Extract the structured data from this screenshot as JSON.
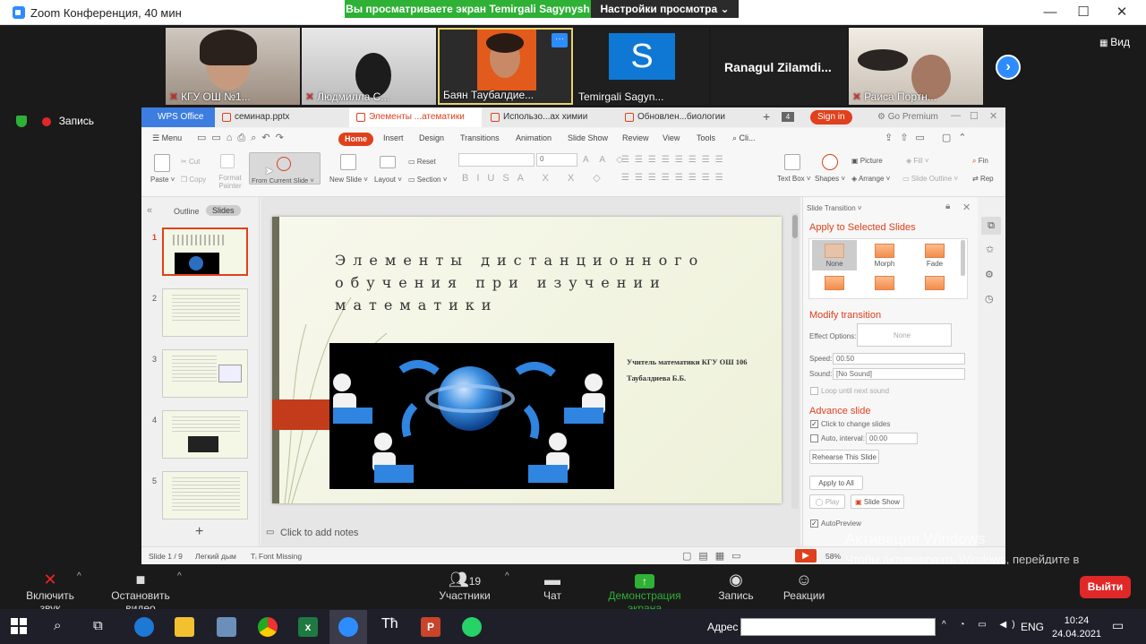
{
  "zoom": {
    "title": "Zoom Конференция, 40 мин",
    "share_banner": "Вы просматриваете экран Temirgali Sagynysh",
    "view_options": "Настройки просмотра ⌄",
    "minimize": "—",
    "maximize": "☐",
    "close": "✕",
    "view_label": "Вид",
    "next_arrow": "›",
    "recording": "Запись",
    "participants": [
      {
        "name": "КГУ ОШ №1..."
      },
      {
        "name": "Людмилла С..."
      },
      {
        "name": "Баян Таубалдие..."
      },
      {
        "name": "Temirgali Sagyn..."
      },
      {
        "name": "Ranagul  Zilamdi..."
      },
      {
        "name": "Раиса Портн..."
      }
    ],
    "tile_more": "···",
    "avatar_letter": "S",
    "toolbar": {
      "unmute": "Включить звук",
      "start_video": "Остановить видео",
      "participants": "Участники",
      "participants_count": "19",
      "chat": "Чат",
      "share": "Демонстрация экрана",
      "record": "Запись",
      "reactions": "Реакции",
      "leave": "Выйти"
    }
  },
  "wps": {
    "tabs": {
      "home": "WPS Office",
      "t1": "семинар.pptx",
      "t2": "Элементы ...атематики",
      "t3": "Использо...ах химии",
      "t4": "Обновлен...биологии"
    },
    "tab_count": "4",
    "sign_in": "Sign in",
    "go_premium": "Go Premium",
    "menu": {
      "menu": "Menu",
      "home": "Home",
      "insert": "Insert",
      "design": "Design",
      "transitions": "Transitions",
      "animation": "Animation",
      "slideshow": "Slide Show",
      "review": "Review",
      "view": "View",
      "tools": "Tools",
      "search": "Cli..."
    },
    "ribbon": {
      "paste": "Paste ˅",
      "cut": "Cut",
      "copy": "Copy",
      "format_painter": "Format Painter",
      "from_current": "From Current Slide ˅",
      "new_slide": "New Slide ˅",
      "layout": "Layout ˅",
      "reset": "Reset",
      "section": "Section ˅",
      "font_size": "0",
      "text_box": "Text Box ˅",
      "shapes": "Shapes ˅",
      "picture": "Picture",
      "fill": "Fill ˅",
      "arrange": "Arrange ˅",
      "slide_outline": "Slide Outline ˅",
      "find": "Fin",
      "replace": "Rep"
    },
    "left_pane": {
      "outline": "Outline",
      "slides": "Slides",
      "add": "+",
      "collapse": "«",
      "numbers": [
        "1",
        "2",
        "3",
        "4",
        "5"
      ]
    },
    "slide": {
      "title": "Элементы дистанционного обучения при изучении математики",
      "teacher_line1": "Учитель математики  КГУ ОШ 106",
      "teacher_line2": "Таубалдиева Б.Б."
    },
    "notes": "Click to add notes",
    "right_pane": {
      "header": "Slide Transition ˅",
      "apply_selected": "Apply to Selected Slides",
      "transitions": [
        "None",
        "Morph",
        "Fade"
      ],
      "modify": "Modify transition",
      "effect_options": "Effect Options:",
      "effect_value": "None",
      "speed_label": "Speed:",
      "speed_value": "00.50",
      "sound_label": "Sound:",
      "sound_value": "[No Sound]",
      "loop": "Loop until next sound",
      "advance": "Advance slide",
      "click_change": "Click to change slides",
      "auto_interval": "Auto, interval:",
      "auto_value": "00:00",
      "rehearse": "Rehearse This Slide",
      "apply_all": "Apply to All",
      "play": "Play",
      "slide_show": "Slide Show",
      "autopreview": "AutoPreview"
    },
    "status": {
      "slide": "Slide 1 / 9",
      "theme": "Легкий дым",
      "font_missing": "Font Missing",
      "zoom": "58%"
    }
  },
  "windows": {
    "activation_title": "Активация Windows",
    "activation_sub": "Чтобы активировать Windows, перейдите в раздел \"Параметры\".",
    "address_label": "Адрес",
    "lang": "ENG",
    "time": "10:24",
    "date": "24.04.2021"
  },
  "colors": {
    "wps_accent": "#e0401c",
    "zoom_blue": "#2d8cff",
    "zoom_green": "#2eb135",
    "leave_red": "#e02828"
  }
}
